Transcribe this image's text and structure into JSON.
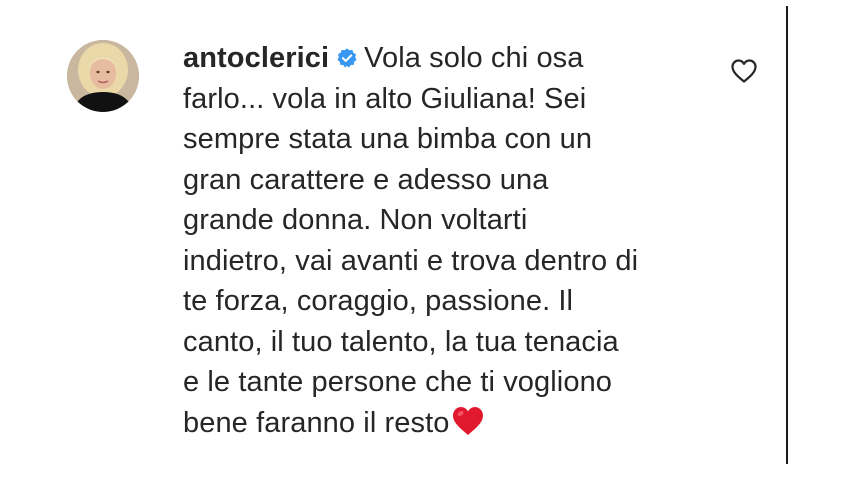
{
  "comment": {
    "username": "antoclerici",
    "verified": true,
    "lines": [
      "Vola solo chi osa",
      "farlo... vola in alto Giuliana! Sei",
      "sempre stata una bimba con un",
      "gran carattere e adesso una",
      "grande donna. Non voltarti",
      "indietro, vai avanti e trova dentro di",
      "te forza, coraggio, passione. Il",
      "canto, il tuo talento, la tua tenacia",
      "e le tante persone che ti vogliono",
      "bene faranno il resto"
    ],
    "emoji": "red-heart-emoji"
  },
  "icons": {
    "verified": "verified-badge-icon",
    "like": "heart-outline-icon"
  },
  "colors": {
    "text": "#262626",
    "verified_badge": "#3897f0",
    "heart_emoji": "#e0192f"
  }
}
